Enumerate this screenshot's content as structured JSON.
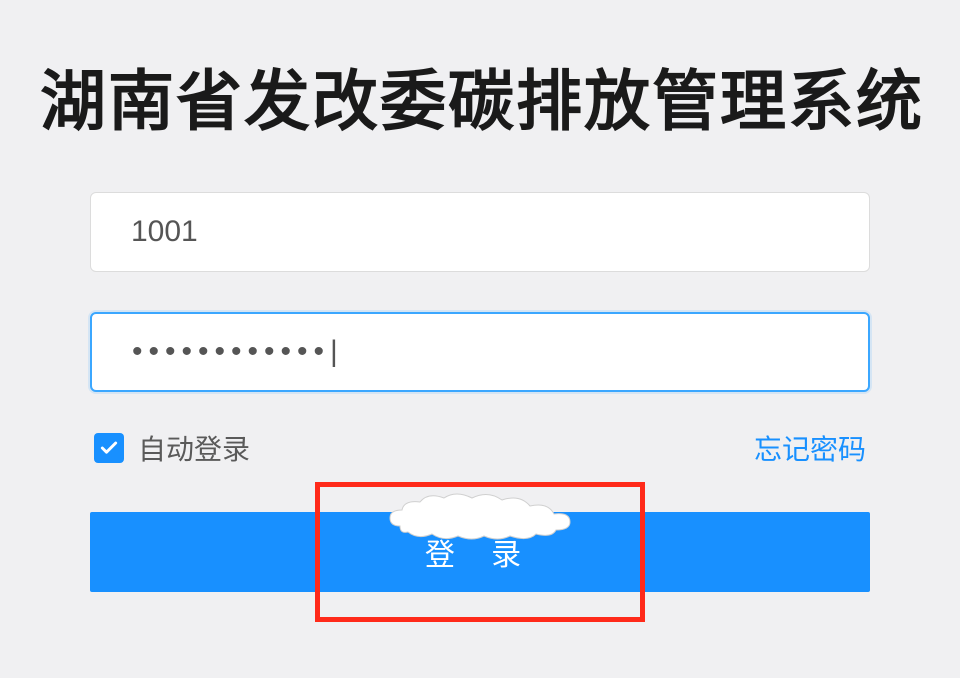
{
  "title": "湖南省发改委碳排放管理系统",
  "form": {
    "username_value": "1001",
    "password_value": "••••••••••••|",
    "auto_login_label": "自动登录",
    "forgot_label": "忘记密码",
    "login_label": "登 录"
  },
  "colors": {
    "primary": "#1890ff",
    "highlight": "#ff2a1a"
  }
}
